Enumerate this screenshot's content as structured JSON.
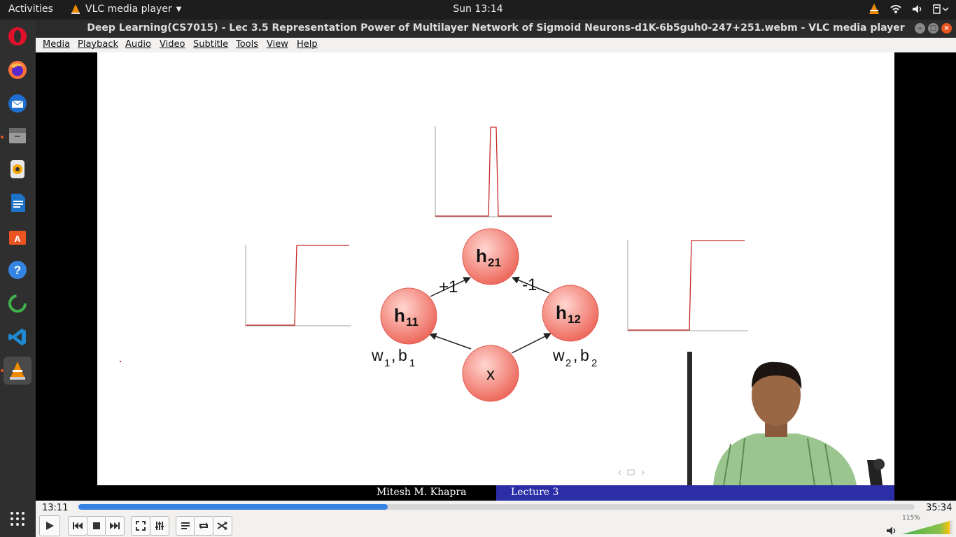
{
  "topbar": {
    "activities": "Activities",
    "app_name": "VLC media player",
    "clock": "Sun 13:14"
  },
  "window": {
    "title": "Deep Learning(CS7015) - Lec 3.5 Representation Power of Multilayer Network of Sigmoid Neurons-d1K-6b5guh0-247+251.webm - VLC media player"
  },
  "menu": [
    "Media",
    "Playback",
    "Audio",
    "Video",
    "Subtitle",
    "Tools",
    "View",
    "Help"
  ],
  "dock": [
    "opera-icon",
    "firefox-icon",
    "thunderbird-icon",
    "files-icon",
    "rhythmbox-icon",
    "writer-icon",
    "software-icon",
    "help-icon",
    "loading-icon",
    "vscode-icon",
    "vlc-icon"
  ],
  "slide": {
    "nodes": {
      "h21": "h",
      "h21_sub": "21",
      "h11": "h",
      "h11_sub": "11",
      "h12": "h",
      "h12_sub": "12",
      "x": "x"
    },
    "edge_labels": {
      "plus": "+1",
      "minus": "-1"
    },
    "weights_left": {
      "w": "w",
      "w_sub": "1",
      "sep": ",",
      "b": "b",
      "b_sub": "1"
    },
    "weights_right": {
      "w": "w",
      "w_sub": "2",
      "sep": ",",
      "b": "b",
      "b_sub": "2"
    },
    "footer_author": "Mitesh M. Khapra",
    "footer_lecture": "Lecture 3"
  },
  "player": {
    "elapsed": "13:11",
    "total": "35:34",
    "progress": 0.37,
    "volume": "115%",
    "colors": {
      "accent": "#3584e4",
      "volume": "#6dbf3a"
    }
  }
}
